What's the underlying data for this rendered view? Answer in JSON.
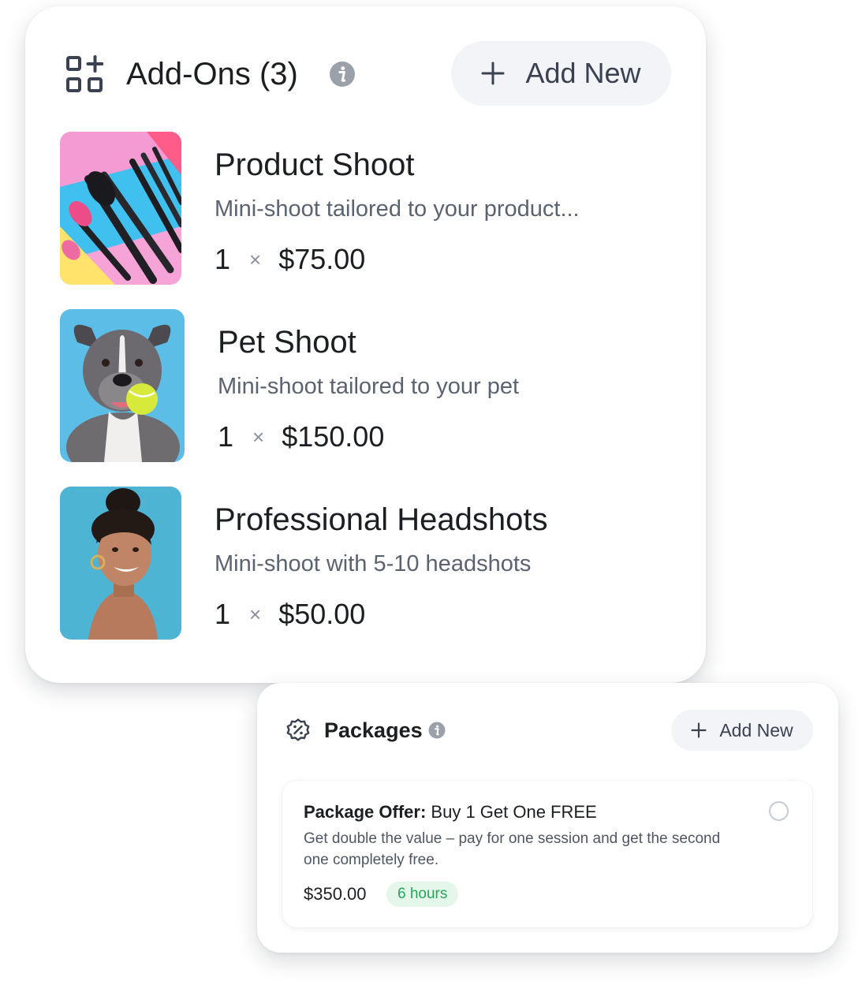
{
  "addons": {
    "title": "Add-Ons (3)",
    "add_new_label": "Add New",
    "items": [
      {
        "title": "Product Shoot",
        "description": "Mini-shoot tailored to your product...",
        "quantity": "1",
        "times": "×",
        "price": "$75.00",
        "image": "makeup-brushes-photo"
      },
      {
        "title": "Pet Shoot",
        "description": "Mini-shoot tailored to your pet",
        "quantity": "1",
        "times": "×",
        "price": "$150.00",
        "image": "dog-with-tennis-ball-photo"
      },
      {
        "title": "Professional Headshots",
        "description": "Mini-shoot with 5-10 headshots",
        "quantity": "1",
        "times": "×",
        "price": "$50.00",
        "image": "smiling-woman-portrait-photo"
      }
    ]
  },
  "packages": {
    "title": "Packages",
    "add_new_label": "Add New",
    "offer": {
      "label": "Package Offer:",
      "name": "Buy 1 Get One FREE",
      "description": "Get double the value – pay for one session and get the second one completely free.",
      "price": "$350.00",
      "duration": "6 hours",
      "selected": false
    }
  },
  "colors": {
    "card_bg": "#ffffff",
    "button_bg": "#f3f4f8",
    "text_primary": "#1c1e21",
    "text_secondary": "#5b6270",
    "badge_bg": "#e4f7ea",
    "badge_text": "#22a85a",
    "icon_gray": "#3a4150",
    "info_icon": "#9ba1ab"
  },
  "icons": [
    "grid-add-icon",
    "info-icon",
    "plus-icon",
    "discount-badge-icon",
    "radio-icon"
  ]
}
